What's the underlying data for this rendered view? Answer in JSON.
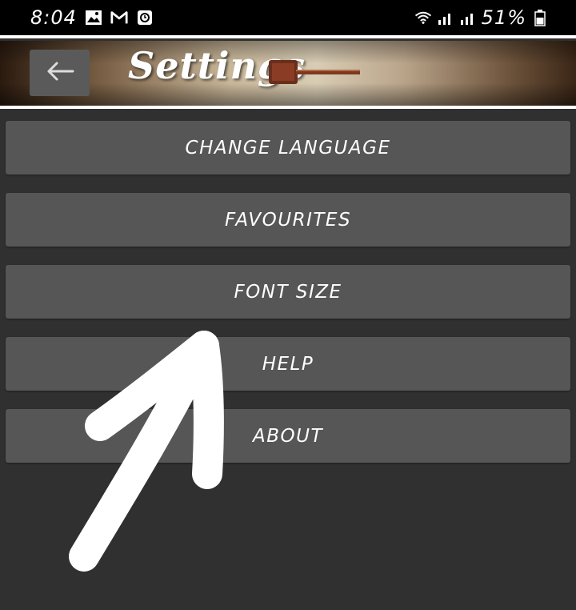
{
  "status_bar": {
    "time": "8:04",
    "battery": "51%",
    "icons": [
      "gallery-icon",
      "gmail-icon",
      "clock-app-icon",
      "wifi-icon",
      "signal-icon",
      "signal-icon",
      "battery-icon"
    ]
  },
  "header": {
    "title": "Settings",
    "back_icon": "arrow-left-icon"
  },
  "menu": {
    "items": [
      {
        "label": "CHANGE LANGUAGE"
      },
      {
        "label": "FAVOURITES"
      },
      {
        "label": "FONT SIZE"
      },
      {
        "label": "HELP"
      },
      {
        "label": "ABOUT"
      }
    ]
  },
  "colors": {
    "background": "#303030",
    "button": "#565656",
    "status_bar": "#000000",
    "text": "#ffffff"
  }
}
